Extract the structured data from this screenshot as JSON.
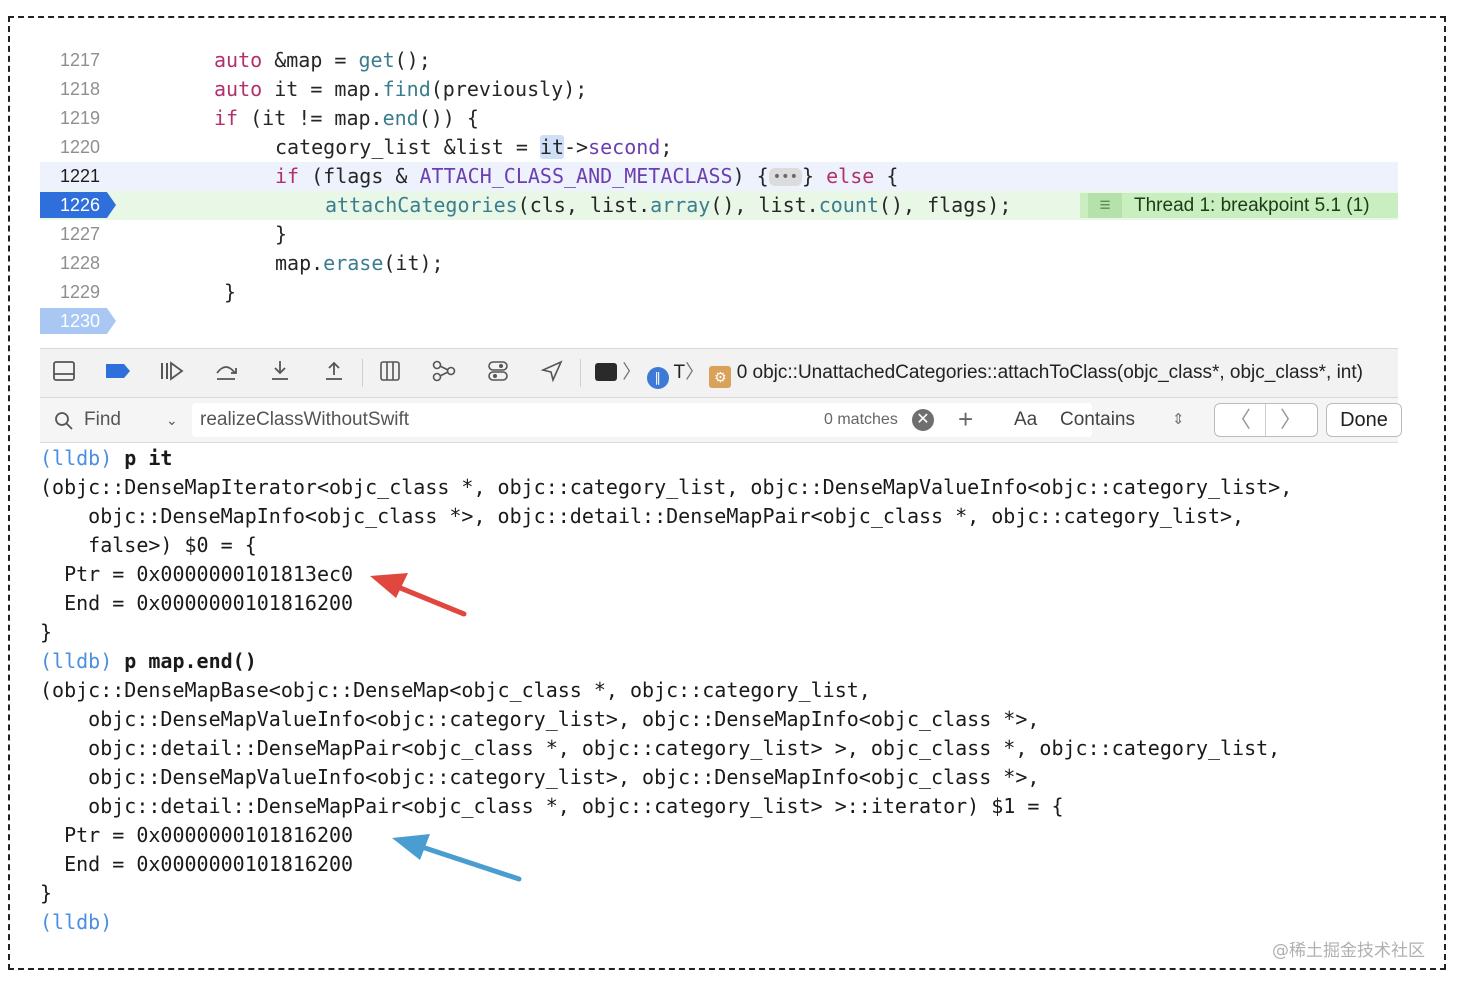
{
  "editor": {
    "lines": [
      {
        "num": "1217",
        "code": "auto &map = get();"
      },
      {
        "num": "1218",
        "code": "auto it = map.find(previously);"
      },
      {
        "num": "1219",
        "code": "if (it != map.end()) {"
      },
      {
        "num": "1220",
        "code": "category_list &list = it->second;"
      },
      {
        "num": "1221",
        "code": "if (flags & ATTACH_CLASS_AND_METACLASS) {•••} else {"
      },
      {
        "num": "1226",
        "code": "attachCategories(cls, list.array(), list.count(), flags);"
      },
      {
        "num": "1227",
        "code": "}"
      },
      {
        "num": "1228",
        "code": "map.erase(it);"
      },
      {
        "num": "1229",
        "code": "}"
      },
      {
        "num": "1230",
        "code": ""
      }
    ],
    "thread_badge": "Thread 1: breakpoint 5.1 (1)",
    "fold_label": "•••"
  },
  "debug_bar": {
    "frame_label": "0 objc::UnattachedCategories::attachToClass(objc_class*, objc_class*, int)",
    "thread_label": "T"
  },
  "find_bar": {
    "mode_label": "Find",
    "query": "realizeClassWithoutSwift",
    "matches": "0 matches",
    "case_label": "Aa",
    "match_mode": "Contains",
    "done_label": "Done"
  },
  "console": {
    "lines": [
      {
        "prompt": "(lldb)",
        "cmd": "p it"
      },
      {
        "text": "(objc::DenseMapIterator<objc_class *, objc::category_list, objc::DenseMapValueInfo<objc::category_list>,"
      },
      {
        "text": "    objc::DenseMapInfo<objc_class *>, objc::detail::DenseMapPair<objc_class *, objc::category_list>,"
      },
      {
        "text": "    false>) $0 = {"
      },
      {
        "text": "  Ptr = 0x0000000101813ec0"
      },
      {
        "text": "  End = 0x0000000101816200"
      },
      {
        "text": "}"
      },
      {
        "prompt": "(lldb)",
        "cmd": "p map.end()"
      },
      {
        "text": "(objc::DenseMapBase<objc::DenseMap<objc_class *, objc::category_list,"
      },
      {
        "text": "    objc::DenseMapValueInfo<objc::category_list>, objc::DenseMapInfo<objc_class *>,"
      },
      {
        "text": "    objc::detail::DenseMapPair<objc_class *, objc::category_list> >, objc_class *, objc::category_list,"
      },
      {
        "text": "    objc::DenseMapValueInfo<objc::category_list>, objc::DenseMapInfo<objc_class *>,"
      },
      {
        "text": "    objc::detail::DenseMapPair<objc_class *, objc::category_list> >::iterator) $1 = {"
      },
      {
        "text": "  Ptr = 0x0000000101816200"
      },
      {
        "text": "  End = 0x0000000101816200"
      },
      {
        "text": "}"
      },
      {
        "prompt": "(lldb)",
        "cmd": ""
      }
    ]
  },
  "annotations": {
    "red_arrow_color": "#e0473f",
    "blue_arrow_color": "#4a9dd0"
  },
  "watermark": "@稀土掘金技术社区"
}
